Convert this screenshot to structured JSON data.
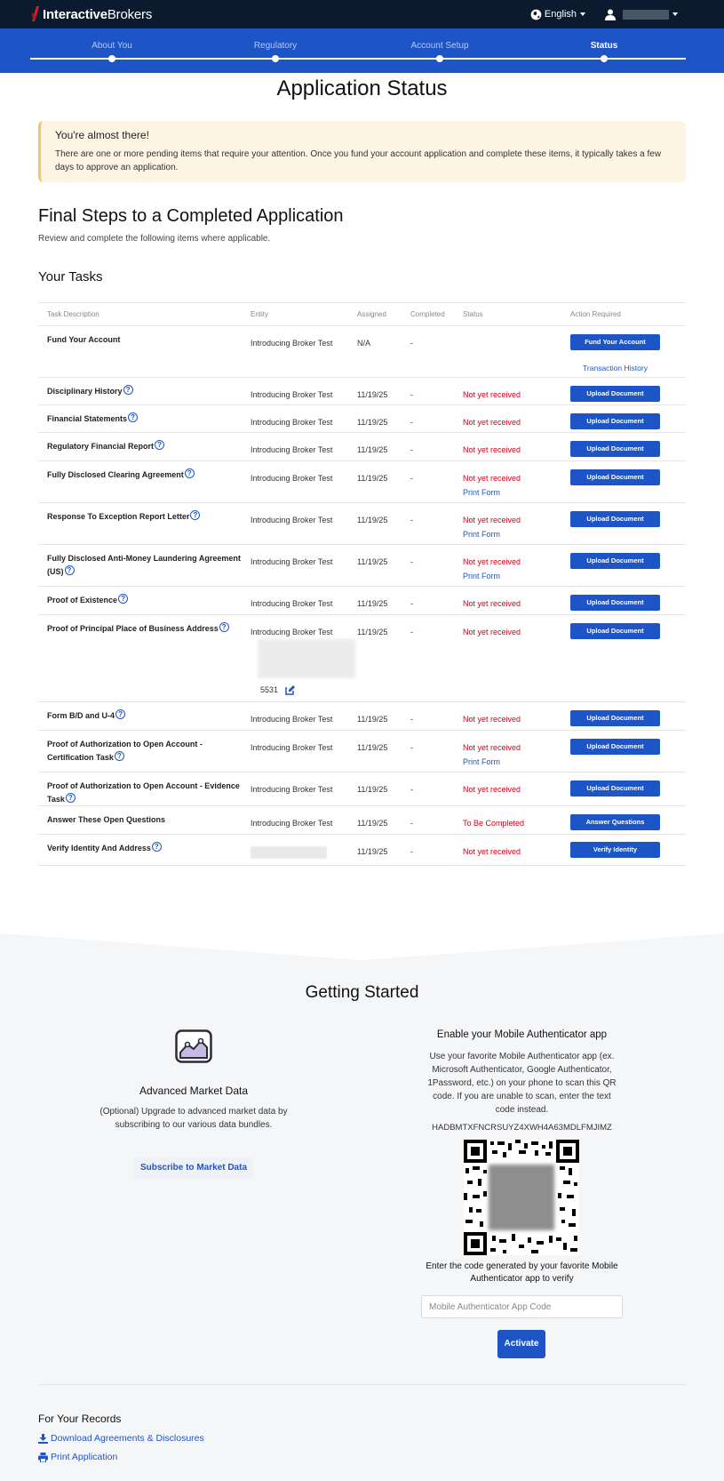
{
  "brand": {
    "name_bold": "Interactive",
    "name_light": "Brokers"
  },
  "header": {
    "language": "English"
  },
  "steps": [
    {
      "label": "About You",
      "active": false
    },
    {
      "label": "Regulatory",
      "active": false
    },
    {
      "label": "Account Setup",
      "active": false
    },
    {
      "label": "Status",
      "active": true
    }
  ],
  "page_title": "Application Status",
  "alert": {
    "title": "You're almost there!",
    "body": "There are one or more pending items that require your attention. Once you fund your account application and complete these items, it typically takes a few days to approve an application."
  },
  "final_steps": {
    "title": "Final Steps to a Completed Application",
    "subtitle": "Review and complete the following items where applicable."
  },
  "tasks": {
    "title": "Your Tasks",
    "columns": [
      "Task Description",
      "Entity",
      "Assigned",
      "Completed",
      "Status",
      "Action Required"
    ],
    "rows": [
      {
        "desc": "Fund Your Account",
        "entity": "Introducing Broker Test",
        "assigned": "N/A",
        "completed": "-",
        "status": "",
        "action": "Fund Your Account",
        "link": "Transaction History"
      },
      {
        "desc": "Disciplinary History",
        "entity": "Introducing Broker Test",
        "assigned": "11/19/25",
        "completed": "-",
        "status": "Not yet received",
        "action": "Upload Document"
      },
      {
        "desc": "Financial Statements",
        "entity": "Introducing Broker Test",
        "assigned": "11/19/25",
        "completed": "-",
        "status": "Not yet received",
        "action": "Upload Document"
      },
      {
        "desc": "Regulatory Financial Report",
        "entity": "Introducing Broker Test",
        "assigned": "11/19/25",
        "completed": "-",
        "status": "Not yet received",
        "action": "Upload Document"
      },
      {
        "desc": "Fully Disclosed Clearing Agreement",
        "entity": "Introducing Broker Test",
        "assigned": "11/19/25",
        "completed": "-",
        "status": "Not yet received",
        "print": "Print Form",
        "action": "Upload Document"
      },
      {
        "desc": "Response To Exception Report Letter",
        "entity": "Introducing Broker Test",
        "assigned": "11/19/25",
        "completed": "-",
        "status": "Not yet received",
        "print": "Print Form",
        "action": "Upload Document"
      },
      {
        "desc": "Fully Disclosed Anti-Money Laundering Agreement (US)",
        "entity": "Introducing Broker Test",
        "assigned": "11/19/25",
        "completed": "-",
        "status": "Not yet received",
        "print": "Print Form",
        "action": "Upload Document"
      },
      {
        "desc": "Proof of Existence",
        "entity": "Introducing Broker Test",
        "assigned": "11/19/25",
        "completed": "-",
        "status": "Not yet received",
        "action": "Upload Document"
      },
      {
        "desc": "Proof of Principal Place of Business Address",
        "entity": "Introducing Broker Test",
        "assigned": "11/19/25",
        "completed": "-",
        "status": "Not yet received",
        "action": "Upload Document",
        "account_suffix": "5531"
      },
      {
        "desc": "Form B/D and U-4",
        "entity": "Introducing Broker Test",
        "assigned": "11/19/25",
        "completed": "-",
        "status": "Not yet received",
        "action": "Upload Document"
      },
      {
        "desc": "Proof of Authorization to Open Account - Certification Task",
        "entity": "Introducing Broker Test",
        "assigned": "11/19/25",
        "completed": "-",
        "status": "Not yet received",
        "print": "Print Form",
        "action": "Upload Document"
      },
      {
        "desc": "Proof of Authorization to Open Account - Evidence Task",
        "entity": "Introducing Broker Test",
        "assigned": "11/19/25",
        "completed": "-",
        "status": "Not yet received",
        "action": "Upload Document"
      },
      {
        "desc": "Answer These Open Questions",
        "entity": "Introducing Broker Test",
        "assigned": "11/19/25",
        "completed": "-",
        "status": "To Be Completed",
        "action": "Answer Questions"
      },
      {
        "desc": "Verify Identity And Address",
        "entity": "",
        "assigned": "11/19/25",
        "completed": "-",
        "status": "Not yet received",
        "action": "Verify Identity"
      }
    ]
  },
  "getting_started": {
    "title": "Getting Started",
    "market": {
      "icon": "chart-icon",
      "title": "Advanced Market Data",
      "desc": "(Optional) Upgrade to advanced market data by subscribing to our various data bundles.",
      "button": "Subscribe to Market Data"
    },
    "auth": {
      "title": "Enable your Mobile Authenticator app",
      "desc": "Use your favorite Mobile Authenticator app (ex. Microsoft Authenticator, Google Authenticator, 1Password, etc.) on your phone to scan this QR code. If you are unable to scan, enter the text code instead.",
      "code": "HADBMTXFNCRSUYZ4XWH4A63MDLFMJIMZ",
      "verify_text": "Enter the code generated by your favorite Mobile Authenticator app to verify",
      "input_placeholder": "Mobile Authenticator App Code",
      "button": "Activate"
    }
  },
  "records": {
    "title": "For Your Records",
    "download": "Download Agreements & Disclosures",
    "print": "Print Application"
  },
  "colors": {
    "primary": "#1e55c6",
    "header": "#0c1a2f",
    "error": "#d0021b",
    "alert_bg": "#fdf4e4"
  }
}
